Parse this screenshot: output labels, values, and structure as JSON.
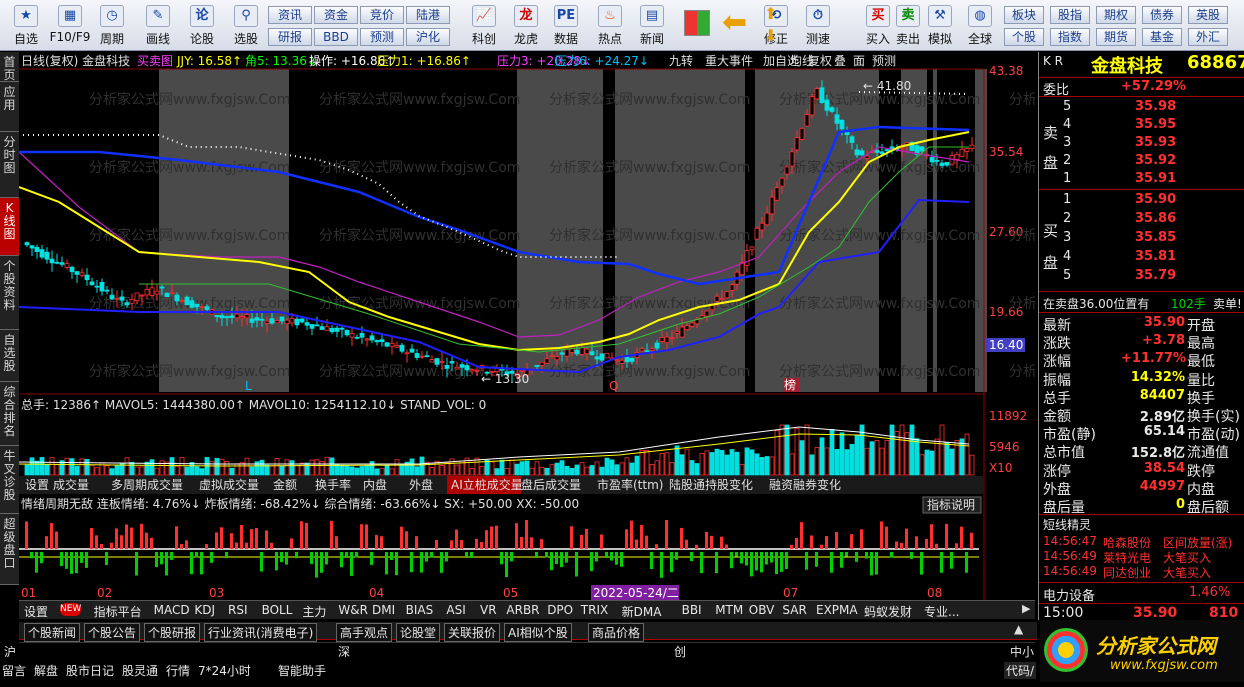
{
  "toolbar": {
    "buttons": [
      {
        "label": "自选",
        "icon": "star-icon"
      },
      {
        "label": "F10/F9",
        "icon": "grid-icon"
      },
      {
        "label": "周期",
        "icon": "clock-icon"
      },
      {
        "label": "画线",
        "icon": "pencil-icon"
      },
      {
        "label": "论股",
        "icon": "talk-icon"
      },
      {
        "label": "选股",
        "icon": "magnifier-icon"
      },
      {
        "label": "科创",
        "icon": "chart-icon"
      },
      {
        "label": "龙虎",
        "icon": "dragon-icon"
      },
      {
        "label": "数据",
        "icon": "pe-icon"
      },
      {
        "label": "热点",
        "icon": "fire-icon"
      },
      {
        "label": "新闻",
        "icon": "news-icon"
      },
      {
        "label": "修正",
        "icon": "clock-edit-icon"
      },
      {
        "label": "测速",
        "icon": "stopwatch-icon"
      },
      {
        "label": "买入",
        "icon": "buy-icon"
      },
      {
        "label": "卖出",
        "icon": "sell-icon"
      },
      {
        "label": "模拟",
        "icon": "hammer-icon"
      },
      {
        "label": "全球",
        "icon": "globe-icon"
      }
    ],
    "top_row": [
      "资讯",
      "资金",
      "竞价",
      "陆港"
    ],
    "bottom_row": [
      "研报",
      "BBD",
      "预测",
      "沪化"
    ],
    "right_top": [
      "板块",
      "股指",
      "期权",
      "债券",
      "英股"
    ],
    "right_bottom": [
      "个股",
      "指数",
      "期货",
      "基金",
      "外汇"
    ]
  },
  "leftnav": [
    "首页",
    "应用",
    "分时图",
    "K线图",
    "个股资料",
    "自选股",
    "综合排名",
    "牛叉诊股",
    "超级盘口"
  ],
  "kline": {
    "header": "日线(复权) 金盘科技",
    "indicator_name": "买卖图",
    "jjy": "JJY: 16.58↑",
    "ma5": "角5: 13.36↓",
    "op": "操作: +16.86↑",
    "p1": "压力1: +16.86↑",
    "p3": "压力3: +20.28↓",
    "p6": "压力6: +24.27↓",
    "tags": [
      "九转",
      "重大事件",
      "加自选",
      "均线",
      "复权",
      "叠",
      "面",
      "预测"
    ],
    "prices": [
      "43.38",
      "35.54",
      "27.60",
      "19.66"
    ],
    "current_price": "16.40",
    "high": "41.80",
    "low": "13.30",
    "markers": [
      "L",
      "Q",
      "榜"
    ]
  },
  "volume": {
    "header": "总手: 12386↑ MAVOL5: 1444380.00↑ MAVOL10: 1254112.10↓ STAND_VOL: 0",
    "scale": [
      "11892",
      "5946",
      "X10"
    ],
    "tabs": [
      "设置",
      "成交量",
      "多周期成交量",
      "虚拟成交量",
      "金额",
      "换手率",
      "内盘",
      "外盘",
      "AI立桩成交量",
      "盘后成交量",
      "市盈率(ttm)",
      "陆股通持股变化",
      "融资融券变化"
    ]
  },
  "emotion": {
    "header": "情绪周期无敌 连板情绪: 4.76%↓ 炸板情绪: -68.42%↓ 综合情绪: -63.66%↓ SX: +50.00 XX: -50.00",
    "help": "指标说明"
  },
  "dates": [
    "01",
    "02",
    "03",
    "04",
    "05",
    "07",
    "08"
  ],
  "date_highlight": "2022-05-24/二",
  "indicator_tabs": [
    "设置",
    "NEW",
    "指标平台",
    "MACD",
    "KDJ",
    "RSI",
    "BOLL",
    "主力",
    "W&R",
    "DMI",
    "BIAS",
    "ASI",
    "VR",
    "ARBR",
    "DPO",
    "TRIX",
    "新DMA",
    "BBI",
    "MTM",
    "OBV",
    "SAR",
    "EXPMA",
    "蚂蚁发财",
    "专业..."
  ],
  "news_tabs": [
    "个股新闻",
    "个股公告",
    "个股研报",
    "行业资讯(消费电子)",
    "高手观点",
    "论股堂",
    "关联报价",
    "AI相似个股",
    "商品价格"
  ],
  "market_row": [
    "沪",
    "深",
    "创",
    "中小"
  ],
  "status_row": [
    "留言",
    "解盘",
    "股市日记",
    "股灵通",
    "行情",
    "7*24小时",
    "智能助手"
  ],
  "code_label": "代码/",
  "watermark": "分析家公式网www.fxgjsw.Com",
  "right": {
    "kr": "K R",
    "name": "金盘科技",
    "code": "68867",
    "weibi_label": "委比",
    "weibi": "+57.29%",
    "sell_label": "卖盘",
    "buy_label": "买盘",
    "asks": [
      {
        "n": "5",
        "p": "35.98"
      },
      {
        "n": "4",
        "p": "35.95"
      },
      {
        "n": "3",
        "p": "35.93"
      },
      {
        "n": "2",
        "p": "35.92"
      },
      {
        "n": "1",
        "p": "35.91"
      }
    ],
    "bids": [
      {
        "n": "1",
        "p": "35.90"
      },
      {
        "n": "2",
        "p": "35.86"
      },
      {
        "n": "3",
        "p": "35.85"
      },
      {
        "n": "4",
        "p": "35.81"
      },
      {
        "n": "5",
        "p": "35.79"
      }
    ],
    "notice": "在卖盘36.00位置有",
    "notice_vol": "102手",
    "notice_end": "卖单!",
    "stats": [
      [
        "最新",
        "35.90",
        "开盘"
      ],
      [
        "涨跌",
        "+3.78",
        "最高"
      ],
      [
        "涨幅",
        "+11.77%",
        "最低"
      ],
      [
        "振幅",
        "14.32%",
        "量比"
      ],
      [
        "总手",
        "84407",
        "换手"
      ],
      [
        "金额",
        "2.89亿",
        "换手(实)"
      ],
      [
        "市盈(静)",
        "65.14",
        "市盈(动)"
      ],
      [
        "总市值",
        "152.8亿",
        "流通值"
      ],
      [
        "涨停",
        "38.54",
        "跌停"
      ],
      [
        "外盘",
        "44997",
        "内盘"
      ],
      [
        "盘后量",
        "0",
        "盘后额"
      ]
    ],
    "elves_title": "短线精灵",
    "elves": [
      [
        "14:56:47",
        "哈森股份",
        "区间放量(涨)"
      ],
      [
        "14:56:49",
        "莱特光电",
        "大笔买入"
      ],
      [
        "14:56:49",
        "同达创业",
        "大笔买入"
      ]
    ],
    "sector": "电力设备",
    "sector_pct": "1.46%",
    "time": "15:00",
    "last_price": "35.90",
    "last_vol": "810"
  },
  "logo": {
    "title": "分析家公式网",
    "url": "www.fxgjsw.com"
  },
  "colors": {
    "up": "#ff3030",
    "down": "#00e0e0",
    "ma_yellow": "#ffff00",
    "ma_blue": "#1030ff",
    "ma_magenta": "#c020c0",
    "ma_green": "#30c030"
  }
}
